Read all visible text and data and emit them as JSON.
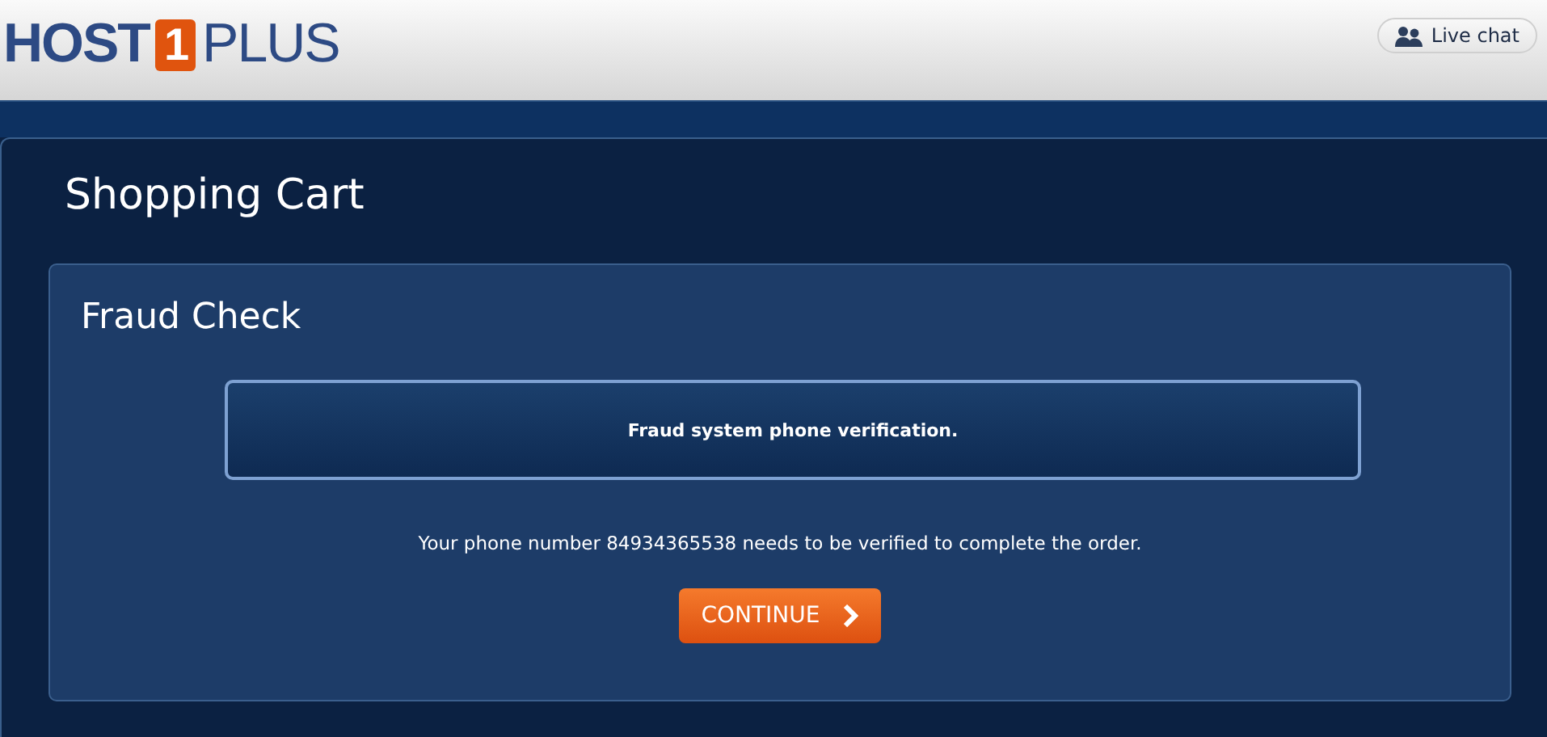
{
  "logo": {
    "first": "HOST",
    "badge": "1",
    "last": "PLUS"
  },
  "live_chat": {
    "label": "Live chat"
  },
  "page_title": "Shopping Cart",
  "section": {
    "title": "Fraud Check",
    "alert": "Fraud system phone verification.",
    "message": "Your phone number 84934365538 needs to be verified to complete the order.",
    "button": "CONTINUE"
  }
}
